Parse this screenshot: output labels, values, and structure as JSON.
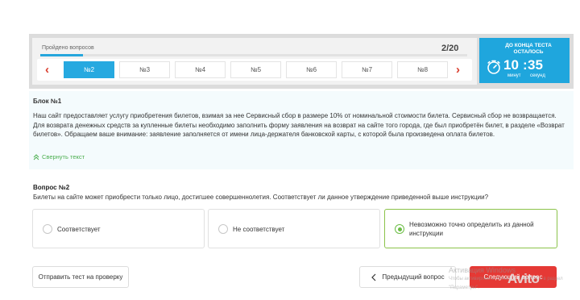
{
  "progress": {
    "label": "Пройдено вопросов",
    "count": "2/20",
    "fraction": 0.1
  },
  "nav": {
    "prev_arrow": "‹",
    "next_arrow": "›",
    "questions": [
      {
        "label": "№2",
        "active": true
      },
      {
        "label": "№3",
        "active": false
      },
      {
        "label": "№4",
        "active": false
      },
      {
        "label": "№5",
        "active": false
      },
      {
        "label": "№6",
        "active": false
      },
      {
        "label": "№7",
        "active": false
      },
      {
        "label": "№8",
        "active": false
      }
    ]
  },
  "timer": {
    "title_line1": "ДО КОНЦА ТЕСТА",
    "title_line2": "ОСТАЛОСЬ",
    "minutes": "10",
    "colon": ":",
    "seconds": "35",
    "minutes_label": "минут",
    "seconds_label": "секунд",
    "icon": "stopwatch-icon"
  },
  "block": {
    "title": "Блок №1",
    "text": "Наш сайт предоставляет услугу приобретения билетов, взимая за нее Сервисный сбор в размере 10% от номинальной стоимости билета. Сервисный сбор не возвращается. Для возврата денежных средств за купленные билеты необходимо заполнить форму заявления на возврат на сайте того города, где был приобретён билет, в разделе «Возврат билетов». Обращаем ваше внимание: заявление заполняется от имени лица-держателя банковской карты, с которой была произведена оплата билетов.",
    "collapse_label": "Свернуть текст",
    "collapse_icon": "double-chevron-up-icon"
  },
  "question": {
    "title": "Вопрос №2",
    "text": "Билеты на сайте может приобрести только лицо, достигшее совершеннолетия. Соответствует ли данное утверждение приведенной выше инструкции?"
  },
  "answers": [
    {
      "label": "Соответствует",
      "selected": false
    },
    {
      "label": "Не соответствует",
      "selected": false
    },
    {
      "label_line1": "Невозможно точно определить из данной",
      "label_line2": "инструкции",
      "selected": true
    }
  ],
  "buttons": {
    "submit": "Отправить тест на проверку",
    "prev": "Предыдущий вопрос",
    "prev_icon": "chevron-left-icon",
    "next": "Следующий вопрос"
  },
  "watermark": {
    "line1": "Активация Windows",
    "line2": "Чтобы активировать Windows, перейдите в раздел",
    "line3": "\"Параметры\".",
    "logo": "Avito"
  },
  "colors": {
    "accent": "#26a9e0",
    "arrow": "#d93b2b",
    "selected": "#6bbd45",
    "next_button": "#e53935"
  }
}
